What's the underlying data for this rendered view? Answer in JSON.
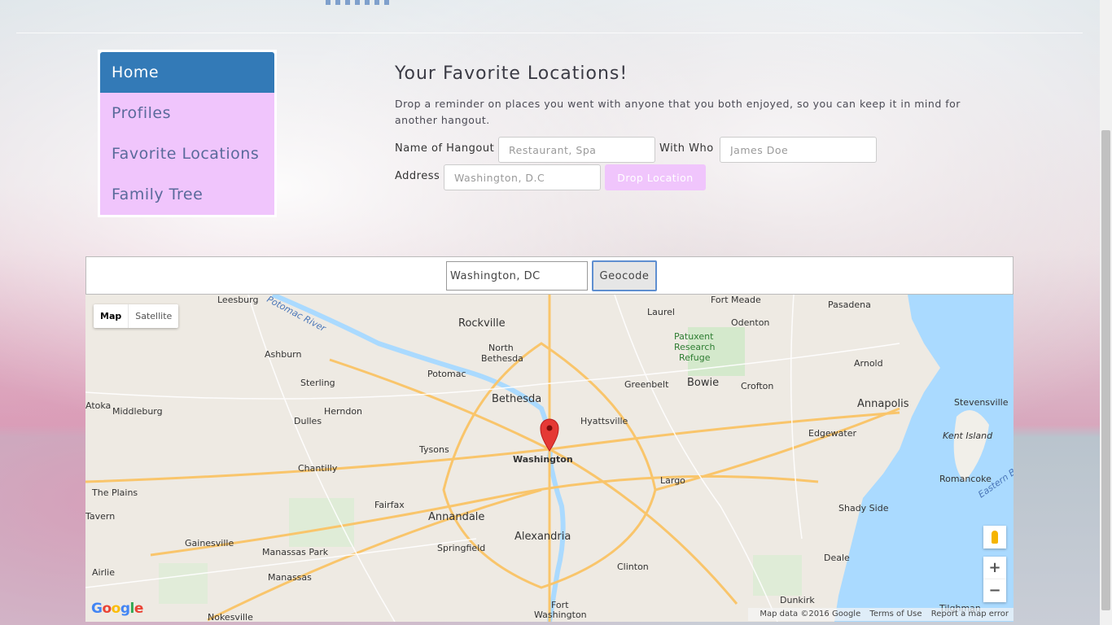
{
  "nav": {
    "items": [
      {
        "label": "Home",
        "active": true
      },
      {
        "label": "Profiles",
        "active": false
      },
      {
        "label": "Favorite Locations",
        "active": false
      },
      {
        "label": "Family Tree",
        "active": false
      }
    ]
  },
  "main": {
    "title": "Your Favorite Locations!",
    "description": "Drop a reminder on places you went with anyone that you both enjoyed, so you can keep it in mind for another hangout.",
    "form": {
      "hangout_label": "Name of Hangout",
      "hangout_placeholder": "Restaurant, Spa",
      "with_label": "With Who",
      "with_placeholder": "James Doe",
      "address_label": "Address",
      "address_placeholder": "Washington, D.C",
      "drop_button": "Drop Location"
    }
  },
  "geocode": {
    "input_value": "Washington, DC",
    "button_label": "Geocode"
  },
  "map": {
    "type_map": "Map",
    "type_satellite": "Satellite",
    "zoom_in": "+",
    "zoom_out": "−",
    "logo": "Google",
    "attribution": "Map data ©2016 Google",
    "terms": "Terms of Use",
    "report": "Report a map error",
    "center_label": "Washington",
    "places": [
      "Leesburg",
      "Rockville",
      "Laurel",
      "Fort Meade",
      "Pasadena",
      "Odenton",
      "Potomac",
      "North Bethesda",
      "Ashburn",
      "Sterling",
      "Bowie",
      "Crofton",
      "Arnold",
      "Greenbelt",
      "Annapolis",
      "Stevensville",
      "Bethesda",
      "Herndon",
      "Hyattsville",
      "Middleburg",
      "Dulles",
      "Edgewater",
      "Kent Island",
      "Tysons",
      "Chantilly",
      "Romancoke",
      "Largo",
      "The Plains",
      "Fairfax",
      "Annandale",
      "Shady Side",
      "Alexandria",
      "Springfield",
      "Gainesville",
      "Manassas Park",
      "Clinton",
      "Deale",
      "Airlie",
      "Manassas",
      "Dunkirk",
      "Nokesville",
      "Fort Washington",
      "Tilghman",
      "Patuxent Research Refuge",
      "Potomac River",
      "Tavern",
      "Atoka",
      "Eastern Bay"
    ]
  },
  "colors": {
    "nav_active": "#337ab7",
    "nav_item": "#f0c5fc",
    "drop_button": "#f0c5fc",
    "water": "#aadaff",
    "marker": "#e53935"
  }
}
